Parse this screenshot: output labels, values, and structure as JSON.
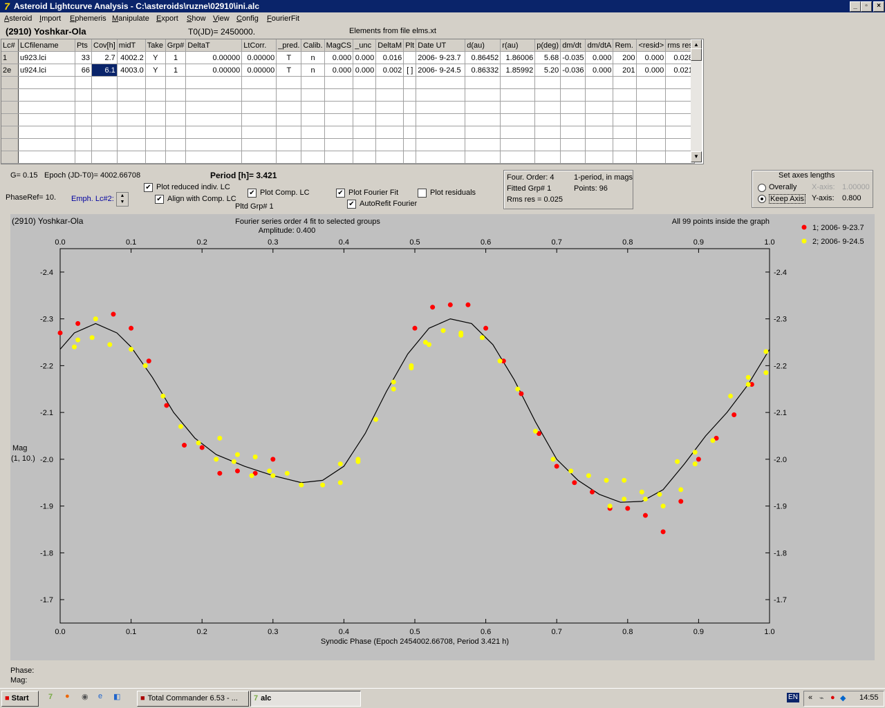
{
  "window": {
    "title": "Asteroid Lightcurve Analysis - C:\\asteroids\\ruzne\\02910\\ini.alc",
    "min": "_",
    "restore": "▫",
    "close": "×"
  },
  "menu": [
    "Asteroid",
    "Import",
    "Ephemeris",
    "Manipulate",
    "Export",
    "Show",
    "View",
    "Config",
    "FourierFit"
  ],
  "header": {
    "asteroid": "(2910) Yoshkar-Ola",
    "t0": "T0(JD)= 2450000.",
    "elements": "Elements from file elms.xt"
  },
  "table": {
    "columns": [
      "Lc#",
      "LCfilename",
      "Pts",
      "Cov[h]",
      "midT",
      "Take",
      "Grp#",
      "DeltaT",
      "LtCorr.",
      "_pred.",
      "Calib.",
      "MagCS",
      "_unc",
      "DeltaM",
      "Plt",
      "Date UT",
      "d(au)",
      "r(au)",
      "p(deg)",
      "dm/dt",
      "dm/dtA",
      "Rem.",
      "<resid>",
      "rms res"
    ],
    "rows": [
      [
        "1",
        "u923.lci",
        "33",
        "2.7",
        "4002.2",
        "Y",
        "1",
        "0.00000",
        "0.00000",
        "T",
        "n",
        "0.000",
        "0.000",
        "0.016",
        "",
        "2006- 9-23.7",
        "0.86452",
        "1.86006",
        "5.68",
        "-0.035",
        "0.000",
        "200",
        "0.000",
        "0.028"
      ],
      [
        "2e",
        "u924.lci",
        "66",
        "6.1",
        "4003.0",
        "Y",
        "1",
        "0.00000",
        "0.00000",
        "T",
        "n",
        "0.000",
        "0.000",
        "0.002",
        "[ ]",
        "2006- 9-24.5",
        "0.86332",
        "1.85992",
        "5.20",
        "-0.036",
        "0.000",
        "201",
        "0.000",
        "0.021"
      ]
    ],
    "empty_rows": 7
  },
  "params": {
    "g": "G= 0.15",
    "epoch": "Epoch (JD-T0)= 4002.66708",
    "period": "Period [h]= 3.421",
    "phase_ref": "PhaseRef= 10.",
    "emph": "Emph. Lc#2:",
    "pltd_grp": "Pltd Grp#  1"
  },
  "options": {
    "plot_reduced": "Plot reduced indiv. LC",
    "align": "Align with Comp. LC",
    "plot_comp": "Plot Comp. LC",
    "plot_fourier": "Plot Fourier Fit",
    "autorefit": "AutoRefit Fourier",
    "plot_resid": "Plot residuals"
  },
  "fourier_info": {
    "order": "Four. Order:  4",
    "fitted": "Fitted Grp# 1",
    "rms": "Rms res      = 0.025",
    "period_mode": "1-period, in mags",
    "points": "Points: 96"
  },
  "axes_panel": {
    "title": "Set axes lengths",
    "overally": "Overally",
    "keep": "Keep Axis",
    "xaxis": "X-axis:",
    "xval": "1.00000",
    "yaxis": "Y-axis:",
    "yval": "0.800"
  },
  "chart_title": {
    "left": "(2910) Yoshkar-Ola",
    "center": "Fourier series order 4 fit to selected groups",
    "amp": "Amplitude: 0.400",
    "right": "All 99 points inside the graph"
  },
  "status": {
    "phase": "Phase:",
    "mag": "Mag:"
  },
  "taskbar": {
    "start": "Start",
    "app1": "Total Commander 6.53 - ...",
    "app2": "alc",
    "lang": "EN",
    "clock": "14:55"
  },
  "colors": {
    "series1": "#ff0000",
    "series2": "#ffff00",
    "plot_bg": "#c0c0c0",
    "titlebar": "#0a246a"
  },
  "chart_data": {
    "type": "scatter",
    "xlabel": "Synodic Phase (Epoch 2454002.66708, Period 3.421 h)",
    "ylabel": "Mag",
    "ylabel2": "(1, 10.)",
    "xlim": [
      0,
      1
    ],
    "ylim": [
      -2.45,
      -1.65
    ],
    "y_inverted": true,
    "xticks": [
      "0.0",
      "0.1",
      "0.2",
      "0.3",
      "0.4",
      "0.5",
      "0.6",
      "0.7",
      "0.8",
      "0.9",
      "1.0"
    ],
    "yticks": [
      "-2.4",
      "-2.3",
      "-2.2",
      "-2.1",
      "-2.0",
      "-1.9",
      "-1.8",
      "-1.7"
    ],
    "legend_position": "top-right",
    "series": [
      {
        "name": "1; 2006- 9-23.7",
        "color": "#ff0000",
        "points": [
          [
            0.0,
            -2.27
          ],
          [
            0.025,
            -2.29
          ],
          [
            0.075,
            -2.31
          ],
          [
            0.1,
            -2.28
          ],
          [
            0.125,
            -2.21
          ],
          [
            0.15,
            -2.115
          ],
          [
            0.175,
            -2.03
          ],
          [
            0.2,
            -2.025
          ],
          [
            0.225,
            -1.97
          ],
          [
            0.25,
            -1.975
          ],
          [
            0.275,
            -1.97
          ],
          [
            0.3,
            -2.0
          ],
          [
            0.5,
            -2.28
          ],
          [
            0.525,
            -2.325
          ],
          [
            0.55,
            -2.33
          ],
          [
            0.575,
            -2.33
          ],
          [
            0.6,
            -2.28
          ],
          [
            0.625,
            -2.21
          ],
          [
            0.65,
            -2.14
          ],
          [
            0.675,
            -2.055
          ],
          [
            0.7,
            -1.985
          ],
          [
            0.725,
            -1.95
          ],
          [
            0.75,
            -1.93
          ],
          [
            0.775,
            -1.895
          ],
          [
            0.8,
            -1.895
          ],
          [
            0.825,
            -1.88
          ],
          [
            0.85,
            -1.845
          ],
          [
            0.875,
            -1.91
          ],
          [
            0.9,
            -2.0
          ],
          [
            0.925,
            -2.045
          ],
          [
            0.95,
            -2.095
          ],
          [
            0.975,
            -2.16
          ]
        ]
      },
      {
        "name": "2; 2006- 9-24.5",
        "color": "#ffff00",
        "points": [
          [
            0.02,
            -2.24
          ],
          [
            0.025,
            -2.255
          ],
          [
            0.045,
            -2.26
          ],
          [
            0.05,
            -2.3
          ],
          [
            0.07,
            -2.245
          ],
          [
            0.1,
            -2.235
          ],
          [
            0.12,
            -2.2
          ],
          [
            0.145,
            -2.135
          ],
          [
            0.17,
            -2.07
          ],
          [
            0.195,
            -2.035
          ],
          [
            0.22,
            -2.0
          ],
          [
            0.225,
            -2.045
          ],
          [
            0.245,
            -1.995
          ],
          [
            0.25,
            -2.01
          ],
          [
            0.27,
            -1.965
          ],
          [
            0.275,
            -2.005
          ],
          [
            0.295,
            -1.975
          ],
          [
            0.3,
            -1.965
          ],
          [
            0.32,
            -1.97
          ],
          [
            0.34,
            -1.945
          ],
          [
            0.37,
            -1.945
          ],
          [
            0.395,
            -1.95
          ],
          [
            0.395,
            -1.99
          ],
          [
            0.42,
            -1.995
          ],
          [
            0.42,
            -2.0
          ],
          [
            0.445,
            -2.085
          ],
          [
            0.47,
            -2.15
          ],
          [
            0.47,
            -2.165
          ],
          [
            0.495,
            -2.195
          ],
          [
            0.495,
            -2.2
          ],
          [
            0.515,
            -2.25
          ],
          [
            0.52,
            -2.245
          ],
          [
            0.54,
            -2.275
          ],
          [
            0.565,
            -2.265
          ],
          [
            0.565,
            -2.27
          ],
          [
            0.595,
            -2.26
          ],
          [
            0.62,
            -2.21
          ],
          [
            0.645,
            -2.15
          ],
          [
            0.67,
            -2.06
          ],
          [
            0.695,
            -2.0
          ],
          [
            0.72,
            -1.975
          ],
          [
            0.745,
            -1.965
          ],
          [
            0.77,
            -1.955
          ],
          [
            0.775,
            -1.9
          ],
          [
            0.795,
            -1.955
          ],
          [
            0.795,
            -1.915
          ],
          [
            0.82,
            -1.93
          ],
          [
            0.825,
            -1.915
          ],
          [
            0.845,
            -1.925
          ],
          [
            0.85,
            -1.9
          ],
          [
            0.87,
            -1.995
          ],
          [
            0.875,
            -1.935
          ],
          [
            0.895,
            -1.99
          ],
          [
            0.895,
            -2.015
          ],
          [
            0.92,
            -2.04
          ],
          [
            0.945,
            -2.135
          ],
          [
            0.97,
            -2.16
          ],
          [
            0.97,
            -2.175
          ],
          [
            0.995,
            -2.185
          ],
          [
            0.995,
            -2.23
          ]
        ]
      }
    ],
    "fit_curve": {
      "name": "Fourier fit",
      "color": "#000000",
      "points": [
        [
          0.0,
          -2.235
        ],
        [
          0.02,
          -2.27
        ],
        [
          0.05,
          -2.29
        ],
        [
          0.08,
          -2.27
        ],
        [
          0.1,
          -2.24
        ],
        [
          0.13,
          -2.175
        ],
        [
          0.16,
          -2.1
        ],
        [
          0.19,
          -2.045
        ],
        [
          0.22,
          -2.01
        ],
        [
          0.26,
          -1.985
        ],
        [
          0.3,
          -1.965
        ],
        [
          0.34,
          -1.95
        ],
        [
          0.37,
          -1.955
        ],
        [
          0.4,
          -1.985
        ],
        [
          0.43,
          -2.055
        ],
        [
          0.46,
          -2.145
        ],
        [
          0.49,
          -2.225
        ],
        [
          0.52,
          -2.28
        ],
        [
          0.55,
          -2.3
        ],
        [
          0.58,
          -2.29
        ],
        [
          0.61,
          -2.245
        ],
        [
          0.64,
          -2.17
        ],
        [
          0.67,
          -2.08
        ],
        [
          0.7,
          -2.0
        ],
        [
          0.73,
          -1.955
        ],
        [
          0.76,
          -1.925
        ],
        [
          0.79,
          -1.908
        ],
        [
          0.82,
          -1.91
        ],
        [
          0.85,
          -1.935
        ],
        [
          0.88,
          -1.99
        ],
        [
          0.91,
          -2.05
        ],
        [
          0.94,
          -2.1
        ],
        [
          0.97,
          -2.16
        ],
        [
          1.0,
          -2.235
        ]
      ]
    }
  }
}
